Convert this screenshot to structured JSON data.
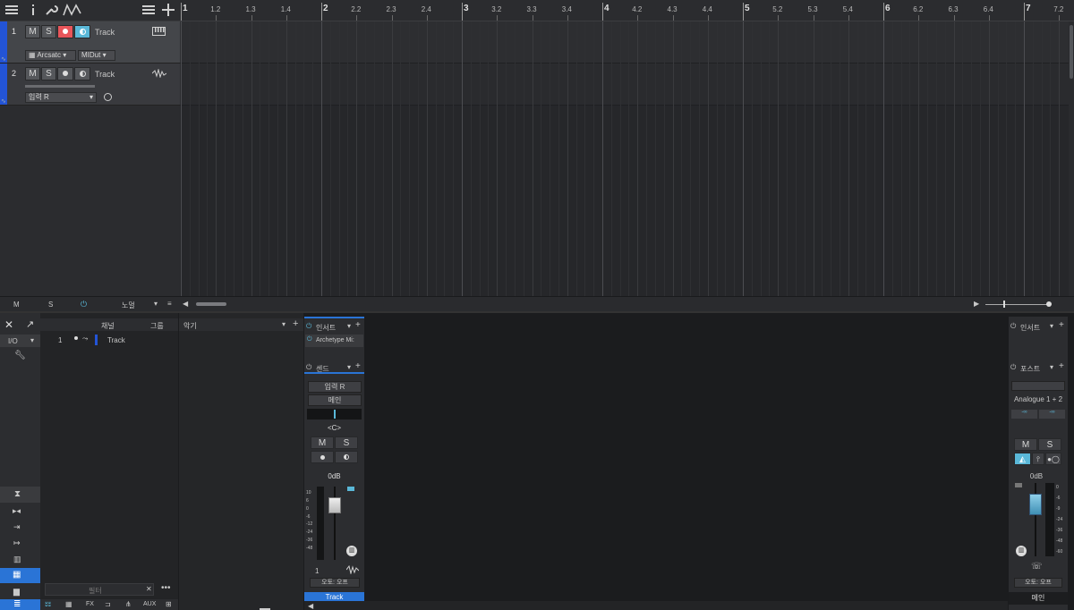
{
  "ruler": {
    "labels": [
      {
        "text": "1",
        "big": true
      },
      {
        "text": "1.2"
      },
      {
        "text": "1.3"
      },
      {
        "text": "1.4"
      },
      {
        "text": "2",
        "big": true
      },
      {
        "text": "2.2"
      },
      {
        "text": "2.3"
      },
      {
        "text": "2.4"
      },
      {
        "text": "3",
        "big": true
      },
      {
        "text": "3.2"
      },
      {
        "text": "3.3"
      },
      {
        "text": "3.4"
      },
      {
        "text": "4",
        "big": true
      },
      {
        "text": "4.2"
      },
      {
        "text": "4.3"
      },
      {
        "text": "4.4"
      },
      {
        "text": "5",
        "big": true
      },
      {
        "text": "5.2"
      },
      {
        "text": "5.3"
      },
      {
        "text": "5.4"
      },
      {
        "text": "6",
        "big": true
      },
      {
        "text": "6.2"
      },
      {
        "text": "6.3"
      },
      {
        "text": "6.4"
      },
      {
        "text": "7",
        "big": true
      },
      {
        "text": "7.2"
      }
    ]
  },
  "tracks": [
    {
      "num": "1",
      "name": "Track",
      "mute": "M",
      "solo": "S",
      "instrument": "Arcsatc",
      "midi": "MIDut"
    },
    {
      "num": "2",
      "name": "Track",
      "mute": "M",
      "solo": "S",
      "input": "입력 R"
    }
  ],
  "status": {
    "m": "M",
    "s": "S",
    "normal": "노멀"
  },
  "browser": {
    "io_label": "I/O",
    "col_channel": "채널",
    "col_group": "그룹",
    "col_instrument": "악기",
    "row_num": "1",
    "row_name": "Track",
    "filter_placeholder": "필터",
    "bottom_tabs": [
      "FX",
      "AUX"
    ]
  },
  "channel": {
    "insert_label": "인서트",
    "insert_plugin": "Archetype Mi:",
    "send_label": "센드",
    "input": "입력 R",
    "output": "메인",
    "pan": "<C>",
    "mute": "M",
    "solo": "S",
    "gain": "0dB",
    "number": "1",
    "auto": "오토: 오프",
    "name": "Track",
    "scale": [
      "10",
      "6",
      "0",
      "-6",
      "-12",
      "-24",
      "-36",
      "-48"
    ]
  },
  "master": {
    "insert_label": "인서트",
    "post_label": "포스트",
    "output": "Analogue 1 + 2",
    "mute": "M",
    "solo": "S",
    "gain": "0dB",
    "auto": "오토: 오프",
    "name": "메인",
    "scale": [
      "0",
      "-6",
      "-9",
      "-24",
      "-36",
      "-48",
      "-60"
    ]
  },
  "colors": {
    "accent": "#2354d6",
    "record": "#e8555a",
    "monitor": "#5ab8d8",
    "selected": "#2a74d6"
  }
}
